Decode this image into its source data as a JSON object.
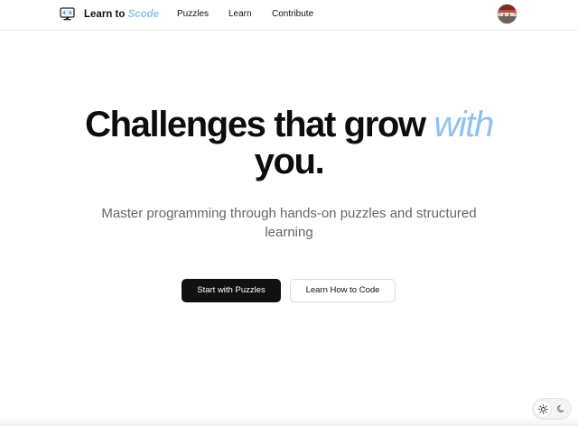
{
  "header": {
    "brand_prefix": "Learn to ",
    "brand_accent": "Scode",
    "nav": [
      "Puzzles",
      "Learn",
      "Contribute"
    ],
    "logo_icon": "monitor-code-icon",
    "avatar_icon": "user-avatar"
  },
  "hero": {
    "title_part1": "Challenges that grow ",
    "title_accent": "with",
    "title_part2": "you.",
    "subtitle": "Master programming through hands-on puzzles and structured learning"
  },
  "actions": {
    "primary": "Start with Puzzles",
    "secondary": "Learn How to Code"
  },
  "theme": {
    "light_icon": "sun-icon",
    "dark_icon": "moon-icon",
    "selected": "light"
  },
  "colors": {
    "accent": "#8ec3ef",
    "primary_button": "#111111",
    "subtitle_text": "#666666"
  }
}
